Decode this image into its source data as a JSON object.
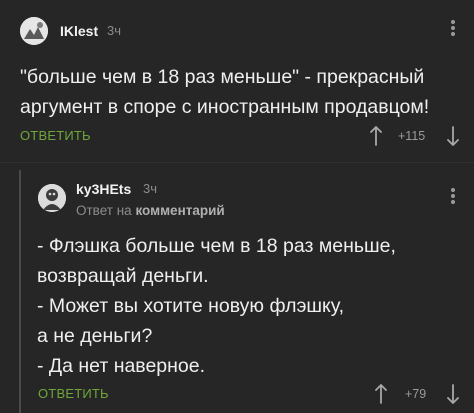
{
  "comment": {
    "author": "IKlest",
    "time": "3ч",
    "text": "\"больше чем в 18 раз меньше\" - прекрасный\nаргумент в споре с иностранным продавцом!",
    "reply_label": "ОТВЕТИТЬ",
    "score": "+115"
  },
  "reply": {
    "author": "ky3HEts",
    "time": "3ч",
    "reply_prefix": "Ответ на",
    "reply_target": "комментарий",
    "text": "- Флэшка больше чем в 18 раз меньше,\nвозвращай деньги.\n- Может вы хотите новую флэшку,\nа не деньги?\n- Да нет наверное.",
    "reply_label": "ОТВЕТИТЬ",
    "score": "+79"
  },
  "colors": {
    "background": "#262626",
    "accent_green": "#6fa63b",
    "muted": "#8c8c8c"
  }
}
